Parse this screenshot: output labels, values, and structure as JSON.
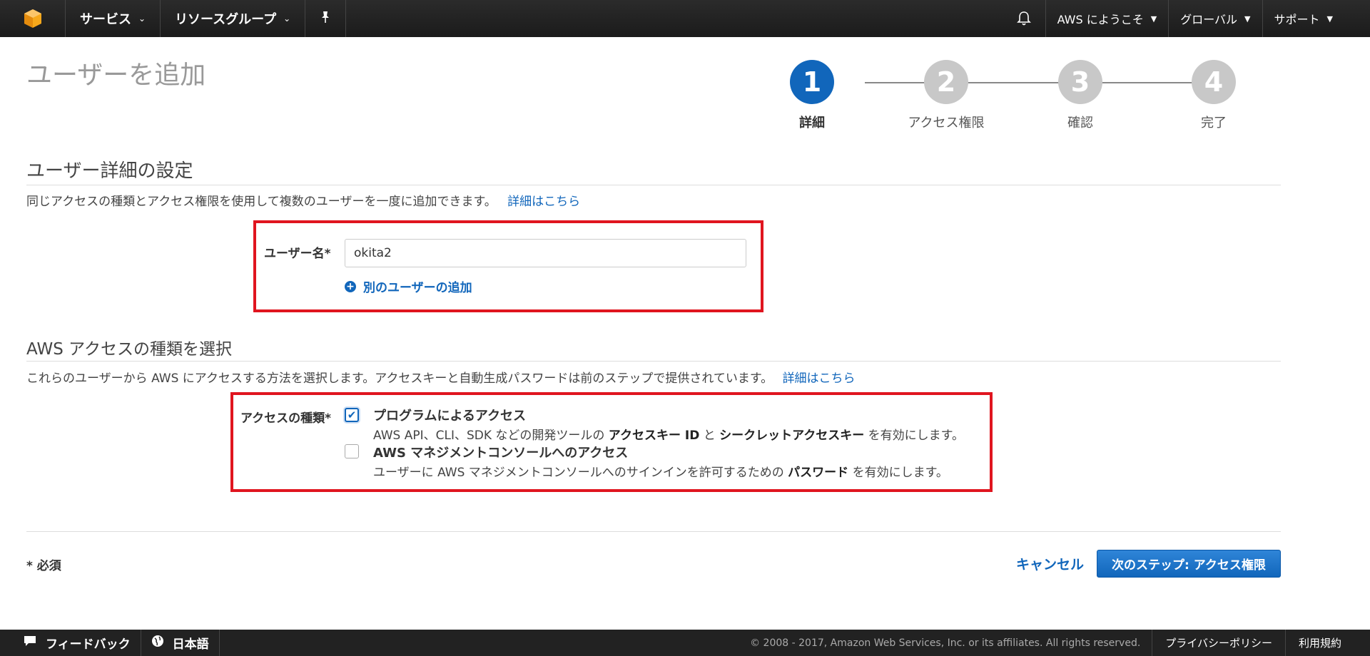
{
  "nav": {
    "services": "サービス",
    "resource_groups": "リソースグループ",
    "account": "AWS にようこそ",
    "region": "グローバル",
    "support": "サポート"
  },
  "page": {
    "title": "ユーザーを追加"
  },
  "steps": [
    {
      "number": "1",
      "label": "詳細",
      "active": true
    },
    {
      "number": "2",
      "label": "アクセス権限",
      "active": false
    },
    {
      "number": "3",
      "label": "確認",
      "active": false
    },
    {
      "number": "4",
      "label": "完了",
      "active": false
    }
  ],
  "user_details": {
    "title": "ユーザー詳細の設定",
    "description": "同じアクセスの種類とアクセス権限を使用して複数のユーザーを一度に追加できます。",
    "learn_more": "詳細はこちら",
    "username_label": "ユーザー名*",
    "username_value": "okita2",
    "add_another": "別のユーザーの追加"
  },
  "access_type": {
    "title": "AWS アクセスの種類を選択",
    "description": "これらのユーザーから AWS にアクセスする方法を選択します。アクセスキーと自動生成パスワードは前のステップで提供されています。",
    "learn_more": "詳細はこちら",
    "label": "アクセスの種類*",
    "options": [
      {
        "title": "プログラムによるアクセス",
        "checked": true,
        "desc_pre": "AWS API、CLI、SDK などの開発ツールの ",
        "desc_bold1": "アクセスキー ID",
        "desc_mid": " と ",
        "desc_bold2": "シークレットアクセスキー",
        "desc_post": " を有効にします。"
      },
      {
        "title": "AWS マネジメントコンソールへのアクセス",
        "checked": false,
        "desc_pre": "ユーザーに AWS マネジメントコンソールへのサインインを許可するための ",
        "desc_bold1": "パスワード",
        "desc_post": " を有効にします。"
      }
    ]
  },
  "actions": {
    "required_note": "* 必須",
    "cancel": "キャンセル",
    "next": "次のステップ: アクセス権限"
  },
  "footer": {
    "feedback": "フィードバック",
    "language": "日本語",
    "copyright": "© 2008 - 2017, Amazon Web Services, Inc. or its affiliates. All rights reserved.",
    "privacy": "プライバシーポリシー",
    "terms": "利用規約"
  },
  "colors": {
    "accent": "#1166bb",
    "highlight_box": "#e0151f",
    "nav_bg": "#232323"
  }
}
